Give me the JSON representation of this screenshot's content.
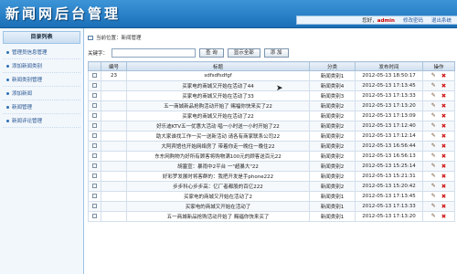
{
  "header": {
    "logo": "新闻网后台管理",
    "welcome": "您好，",
    "user": "admin",
    "change_password": "修改密码",
    "logout": "退出系统"
  },
  "sidebar": {
    "title": "目录列表",
    "items": [
      {
        "label": "管理员信息管理"
      },
      {
        "label": "添加新闻类别"
      },
      {
        "label": "新闻类别管理"
      },
      {
        "label": "添加新闻"
      },
      {
        "label": "新闻管理"
      },
      {
        "label": "新闻评论管理"
      }
    ]
  },
  "breadcrumb": "当前位置：新闻管理",
  "toolbar": {
    "keyword_label": "关键字：",
    "keyword_value": "",
    "query": "查 询",
    "show_all": "显示全部",
    "add": "添 加"
  },
  "table": {
    "headers": [
      "",
      "编号",
      "标题",
      "分类",
      "发布时间",
      "操作"
    ],
    "rows": [
      {
        "id": "23",
        "title": "sdfsdfsdfgf",
        "cat": "新闻类别1",
        "time": "2012-05-13 18:50:17"
      },
      {
        "id": "",
        "title": "买家电的商城又开始在活动了44",
        "cat": "新闻类别4",
        "time": "2012-05-13 17:13:45"
      },
      {
        "id": "",
        "title": "买家电的商城又开始在活动了33",
        "cat": "新闻类别3",
        "time": "2012-05-13 17:13:33"
      },
      {
        "id": "",
        "title": "五一商城新品抢购活动开始了 赐福你快来买了22",
        "cat": "新闻类别2",
        "time": "2012-05-13 17:13:20"
      },
      {
        "id": "",
        "title": "买家电的商城又开始在活动了22",
        "cat": "新闻类别2",
        "time": "2012-05-13 17:13:09"
      },
      {
        "id": "",
        "title": "好乐迪KTV五一优惠大活动 唱一小时送一小时开始了22",
        "cat": "新闻类别2",
        "time": "2012-05-13 17:12:40"
      },
      {
        "id": "",
        "title": "助大家谁找工作一买一送新活动 请各有商家联系公司22",
        "cat": "新闻类别2",
        "time": "2012-05-13 17:12:14"
      },
      {
        "id": "",
        "title": "大阿宾馆也开始网络房了 带着你走一晚住一晚住22",
        "cat": "新闻类别2",
        "time": "2012-05-13 16:56:44"
      },
      {
        "id": "",
        "title": "东东网购物为好所有顾客将购物满100元的顾客送百元22",
        "cat": "新闻类别2",
        "time": "2012-05-13 16:56:13"
      },
      {
        "id": "",
        "title": "胡塞宣：暴雨中2平台 一\"超暴大\"22",
        "cat": "新闻类别2",
        "time": "2012-05-13 15:25:14"
      },
      {
        "id": "",
        "title": "好彩罗发展时将客群的：我把开发是手phone222",
        "cat": "新闻类别2",
        "time": "2012-05-13 15:21:31"
      },
      {
        "id": "",
        "title": "步步科心步步高：亿厂者都股的百亿222",
        "cat": "新闻类别2",
        "time": "2012-05-13 15:20:42"
      },
      {
        "id": "",
        "title": "买家电的商城又开始在活动了2",
        "cat": "新闻类别1",
        "time": "2012-05-13 17:13:45"
      },
      {
        "id": "",
        "title": "买家电的商城又开始在活动了",
        "cat": "新闻类别1",
        "time": "2012-05-13 17:13:33"
      },
      {
        "id": "",
        "title": "五一商城新品抢购活动开始了 赐福你快来买了",
        "cat": "新闻类别1",
        "time": "2012-05-13 17:13:20"
      }
    ],
    "edit_icon": "pencil-icon",
    "delete_icon": "delete-x-icon"
  }
}
